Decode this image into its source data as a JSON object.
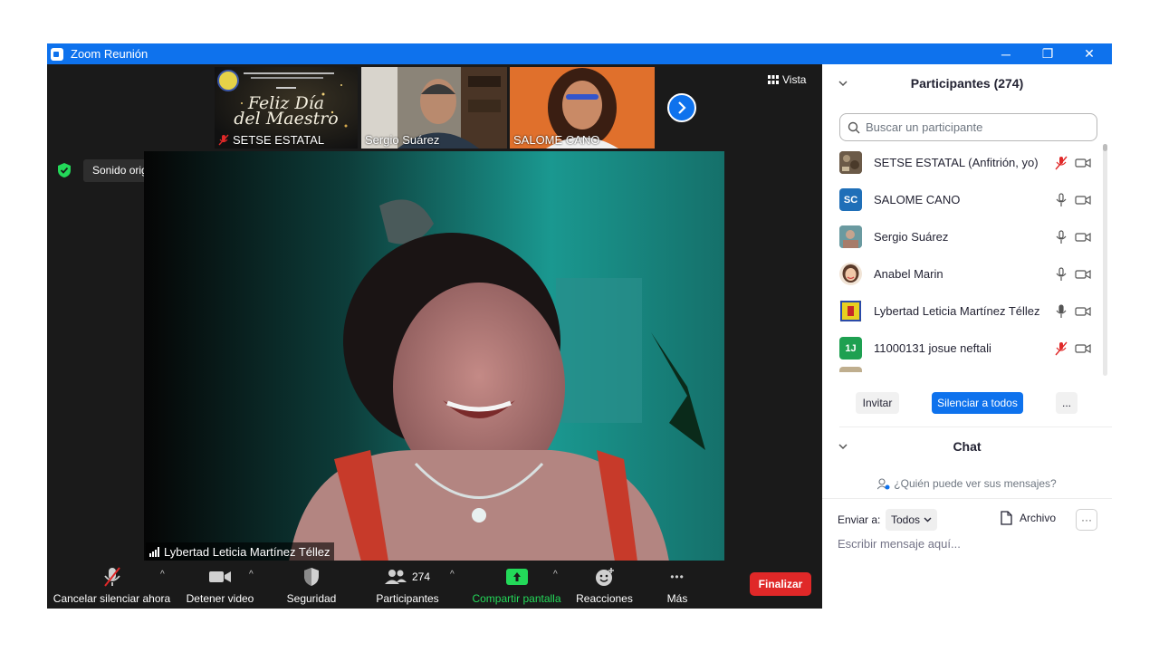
{
  "window": {
    "title": "Zoom Reunión",
    "minimize": "─",
    "maximize": "❐",
    "close": "✕"
  },
  "video": {
    "thumbnails": [
      {
        "name": "SETSE ESTATAL",
        "muted": true,
        "banner_line1": "Feliz Día",
        "banner_line2": "del Maestro"
      },
      {
        "name": "Sergio Suárez",
        "muted": false
      },
      {
        "name": "SALOME CANO",
        "muted": false
      }
    ],
    "next_icon": "chevron-right",
    "vista_label": "Vista",
    "sound_original": "Sonido original: desactivado",
    "active_speaker": "Lybertad Leticia Martínez Téllez"
  },
  "toolbar": {
    "mute_label": "Cancelar silenciar ahora",
    "video_label": "Detener video",
    "security_label": "Seguridad",
    "participants_label": "Participantes",
    "participants_count": "274",
    "share_label": "Compartir pantalla",
    "reactions_label": "Reacciones",
    "more_label": "Más",
    "more_dots": "•••",
    "end_label": "Finalizar"
  },
  "participants_panel": {
    "title": "Participantes (274)",
    "search_placeholder": "Buscar un participante",
    "participants": [
      {
        "name": "SETSE ESTATAL (Anfitrión, yo)",
        "initials": "",
        "avatar_color": "#6b5a48",
        "muted": true
      },
      {
        "name": "SALOME CANO",
        "initials": "SC",
        "avatar_color": "#1f6fb8",
        "muted": false
      },
      {
        "name": "Sergio Suárez",
        "initials": "",
        "avatar_color": "#6a9aa0",
        "muted": false
      },
      {
        "name": "Anabel Marin",
        "initials": "",
        "avatar_color": "#f1e4d6",
        "muted": false
      },
      {
        "name": "Lybertad Leticia Martínez Téllez",
        "initials": "",
        "avatar_color": "#e8d020",
        "muted": false
      },
      {
        "name": "11000131 josue neftali",
        "initials": "1J",
        "avatar_color": "#1ea051",
        "muted": true
      }
    ],
    "invite_label": "Invitar",
    "mute_all_label": "Silenciar a todos",
    "more_label": "..."
  },
  "chat": {
    "title": "Chat",
    "who_can_see": "¿Quién puede ver sus mensajes?",
    "send_to_label": "Enviar a:",
    "send_to_value": "Todos",
    "file_label": "Archivo",
    "more_label": "···",
    "input_placeholder": "Escribir mensaje aquí..."
  },
  "colors": {
    "zoom_blue": "#0e72ed",
    "end_red": "#e02828",
    "share_green": "#23d959",
    "muted_red": "#e02828"
  }
}
